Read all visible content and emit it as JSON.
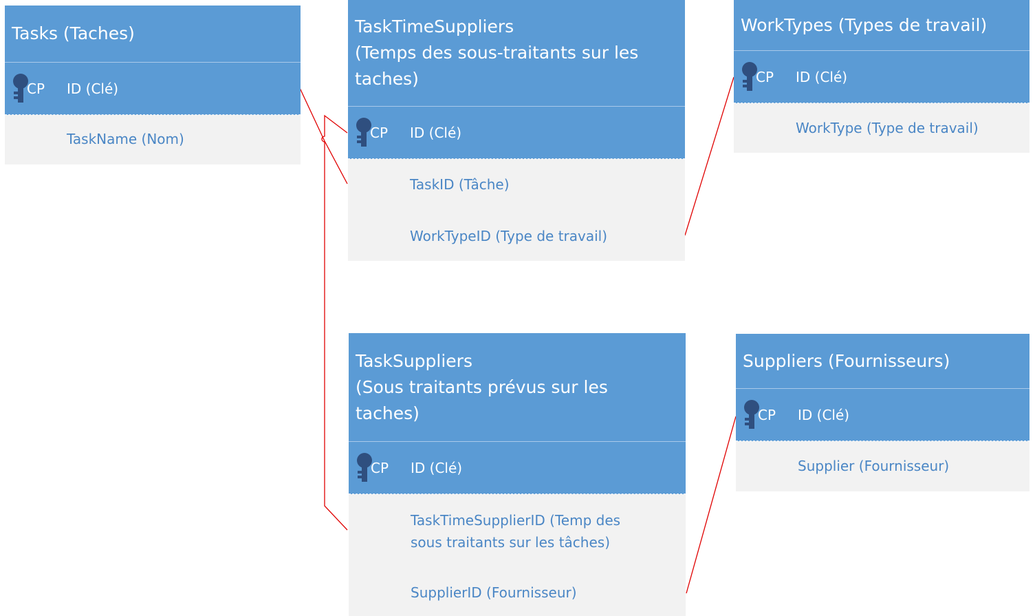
{
  "diagram": {
    "colors": {
      "header": "#5b9bd5",
      "body": "#f2f2f2",
      "field_text": "#4a86c5",
      "connector": "#e00000"
    },
    "pk_badge": "CP",
    "tables": {
      "tasks": {
        "title": "Tasks (Taches)",
        "pk": "ID (Clé)",
        "fields": [
          "TaskName (Nom)"
        ]
      },
      "task_time_suppliers": {
        "title_lines": [
          "TaskTimeSuppliers",
          "(Temps des sous-traitants sur les",
          "taches)"
        ],
        "pk": "ID (Clé)",
        "fields": [
          "TaskID (Tâche)",
          "WorkTypeID (Type de travail)"
        ]
      },
      "work_types": {
        "title": "WorkTypes (Types de travail)",
        "pk": "ID (Clé)",
        "fields": [
          "WorkType (Type de travail)"
        ]
      },
      "task_suppliers": {
        "title_lines": [
          "TaskSuppliers",
          "(Sous traitants prévus sur les",
          "taches)"
        ],
        "pk": "ID (Clé)",
        "fields": [
          [
            "TaskTimeSupplierID (Temp des",
            "sous traitants sur les tâches)"
          ],
          "SupplierID (Fournisseur)"
        ]
      },
      "suppliers": {
        "title": "Suppliers (Fournisseurs)",
        "pk": "ID (Clé)",
        "fields": [
          "Supplier (Fournisseur)"
        ]
      }
    },
    "relationships": [
      {
        "from": "task_time_suppliers.TaskID",
        "to": "tasks.ID"
      },
      {
        "from": "task_time_suppliers.WorkTypeID",
        "to": "work_types.ID"
      },
      {
        "from": "task_suppliers.TaskTimeSupplierID",
        "to": "task_time_suppliers.ID"
      },
      {
        "from": "task_suppliers.SupplierID",
        "to": "suppliers.ID"
      }
    ]
  }
}
